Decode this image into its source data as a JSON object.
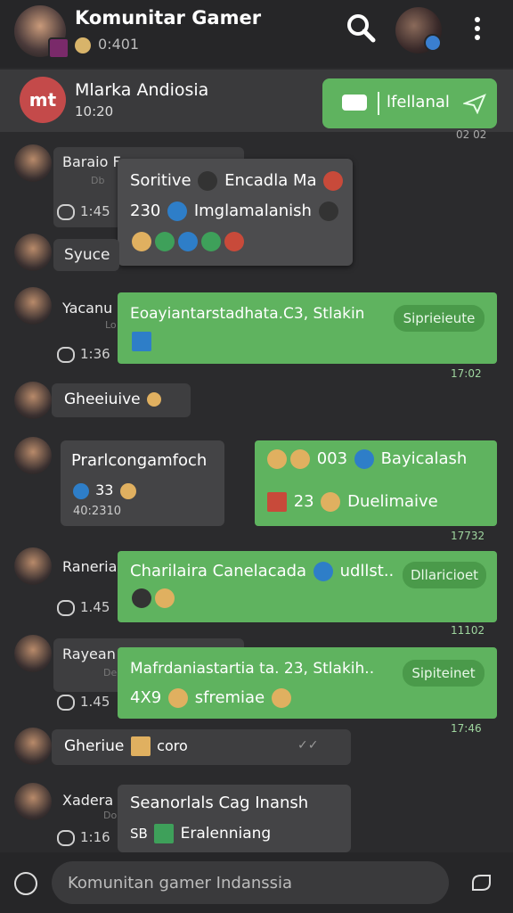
{
  "header": {
    "title": "Komunitar Gamer",
    "subtitle": "0:401",
    "icons": [
      "search-icon",
      "menu-dots-icon"
    ]
  },
  "pinned": {
    "name": "Mlarka Andiosia",
    "time": "10:20",
    "logo_text": "mt",
    "button_label": "lfellanal",
    "stamp": "02 02"
  },
  "messages": [
    {
      "name": "Baraio F",
      "time": "1:45",
      "sub": "Db",
      "popup_line1": "Soritive",
      "popup_line1b": "Encadla Ma",
      "popup_line2": "230",
      "popup_line2b": "Imglamalanish"
    },
    {
      "name": "Syuce"
    },
    {
      "name": "Yacanu",
      "time": "1:36",
      "sub": "Lo",
      "text": "Eoayiantarstadhata.C3, Stlakin",
      "pill": "Siprieieute",
      "stamp": "17:02"
    },
    {
      "name": "Gheeiuive"
    },
    {
      "name": "Prarlcongamfoch",
      "line2": "33",
      "line3": "40:2310",
      "right_line1a": "003",
      "right_line1b": "Bayicalash",
      "right_line2a": "23",
      "right_line2b": "Duelimaive",
      "stamp": "17732"
    },
    {
      "name": "Raneria",
      "time": "1.45",
      "text": "Charilaira Canelacada",
      "text_b": "udllst..",
      "pill": "Dllaricioet",
      "stamp": "11102"
    },
    {
      "name": "Rayean",
      "time": "1.45",
      "sub": "De",
      "text": "Mafrdaniastartia ta. 23, Stlakih..",
      "text2": "4X9",
      "text2b": "sfremiae",
      "pill": "Sipiteinet",
      "stamp": "17:46"
    },
    {
      "name": "Gheriue",
      "text": "coro"
    },
    {
      "name": "Xadera",
      "time": "1:16",
      "sub": "Do",
      "text": "Seanorlals Cag Inansh",
      "text2": "SB",
      "text2b": "Eralenniang"
    }
  ],
  "composer": {
    "placeholder": "Komunitan gamer Indanssia"
  }
}
